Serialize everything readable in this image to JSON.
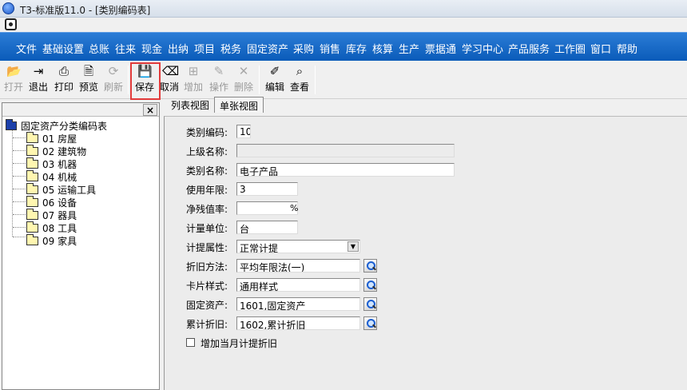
{
  "window": {
    "title": "T3-标准版11.0 - [类别编码表]"
  },
  "menu": [
    "文件",
    "基础设置",
    "总账",
    "往来",
    "现金",
    "出纳",
    "项目",
    "税务",
    "固定资产",
    "采购",
    "销售",
    "库存",
    "核算",
    "生产",
    "票据通",
    "学习中心",
    "产品服务",
    "工作圈",
    "窗口",
    "帮助"
  ],
  "toolbar": {
    "open": "打开",
    "exit": "退出",
    "print": "打印",
    "preview": "预览",
    "refresh": "刷新",
    "save": "保存",
    "cancel": "取消",
    "add": "增加",
    "operate": "操作",
    "delete": "删除",
    "edit": "编辑",
    "view": "查看"
  },
  "left_panel": {
    "close": "×",
    "root": "固定资产分类编码表",
    "items": [
      {
        "code": "01",
        "name": "房屋"
      },
      {
        "code": "02",
        "name": "建筑物"
      },
      {
        "code": "03",
        "name": "机器"
      },
      {
        "code": "04",
        "name": "机械"
      },
      {
        "code": "05",
        "name": "运输工具"
      },
      {
        "code": "06",
        "name": "设备"
      },
      {
        "code": "07",
        "name": "器具"
      },
      {
        "code": "08",
        "name": "工具"
      },
      {
        "code": "09",
        "name": "家具"
      }
    ]
  },
  "tabs": {
    "list": "列表视图",
    "single": "单张视图"
  },
  "form": {
    "code_label": "类别编码:",
    "code_value": "10",
    "parent_label": "上级名称:",
    "parent_value": "",
    "name_label": "类别名称:",
    "name_value": "电子产品",
    "life_label": "使用年限:",
    "life_value": "3",
    "residual_label": "净残值率:",
    "residual_value": "",
    "residual_unit": "%",
    "unit_label": "计量单位:",
    "unit_value": "台",
    "accrual_label": "计提属性:",
    "accrual_value": "正常计提",
    "depr_label": "折旧方法:",
    "depr_value": "平均年限法(一)",
    "card_label": "卡片样式:",
    "card_value": "通用样式",
    "asset_label": "固定资产:",
    "asset_value": "1601,固定资产",
    "accum_label": "累计折旧:",
    "accum_value": "1602,累计折旧",
    "checkbox_label": "增加当月计提折旧"
  },
  "icons": {
    "open": "folder-open-icon",
    "exit": "exit-icon",
    "print": "printer-icon",
    "preview": "preview-icon",
    "refresh": "refresh-icon",
    "save": "floppy-disk-icon",
    "cancel": "cancel-icon",
    "add": "add-icon",
    "operate": "pencil-icon",
    "delete": "delete-icon",
    "edit": "edit-icon",
    "view": "view-icon",
    "lookup": "magnifier-icon"
  }
}
